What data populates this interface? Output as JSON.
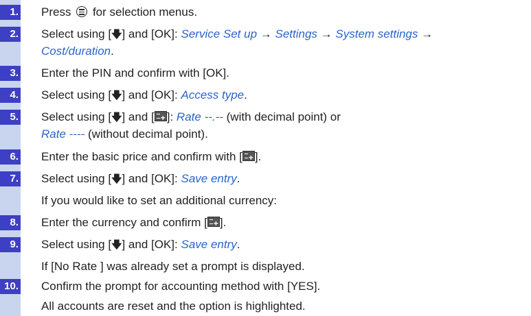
{
  "steps": [
    {
      "num": "1.",
      "pre": "Press",
      "post": "for selection menus."
    },
    {
      "num": "2.",
      "pre": "Select using [",
      "mid": "] and [OK]: ",
      "m1": "Service Set up",
      "arr1": " → ",
      "m2": "Settings",
      "arr2": " → ",
      "m3": "System settings",
      "arr3": " →",
      "m4": "Cost/duration",
      "end": "."
    },
    {
      "num": "3.",
      "text": "Enter the PIN and confirm with [OK]."
    },
    {
      "num": "4.",
      "pre": "Select using [",
      "mid": "] and [OK]: ",
      "m1": "Access type",
      "end": "."
    },
    {
      "num": "5.",
      "pre": "Select using [",
      "mid": "] and [",
      "mid2": "]: ",
      "m1": "Rate --.--",
      "t1": " (with decimal point) or",
      "m2": "Rate ----",
      "t2": " (without decimal point)."
    },
    {
      "num": "6.",
      "pre": "Enter the basic price and confirm with [",
      "end": "]."
    },
    {
      "num": "7.",
      "pre": "Select using [",
      "mid": "] and [OK]: ",
      "m1": "Save entry",
      "end": "."
    },
    {
      "text": "If you would like to set an additional currency:"
    },
    {
      "num": "8.",
      "pre": "Enter the currency and confirm [",
      "end": "]."
    },
    {
      "num": "9.",
      "pre": "Select using [",
      "mid": "] and [OK]: ",
      "m1": "Save entry",
      "end": "."
    },
    {
      "text": "If [No Rate ] was already set a prompt is displayed."
    },
    {
      "num": "10.",
      "text": "Confirm the prompt for accounting method with [YES]."
    },
    {
      "text": "All accounts are reset and the option is highlighted."
    }
  ],
  "colors": {
    "number_bg": "#3d3fc4",
    "rail_bg": "#c9d5ee",
    "menu_text": "#2a64c8"
  },
  "icons": {
    "menu_key": "menu-key-icon",
    "down_arrow": "down-arrow-icon",
    "softkey": "display-softkey-icon"
  }
}
